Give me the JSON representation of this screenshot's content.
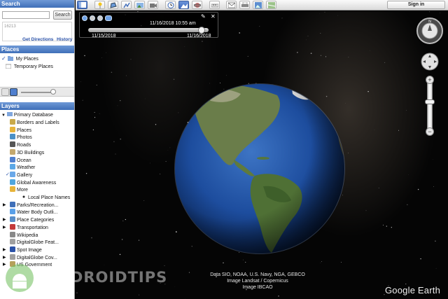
{
  "search": {
    "title": "Search",
    "button_label": "Search",
    "history_value": "16213",
    "get_directions": "Get Directions",
    "history_link": "History"
  },
  "places": {
    "title": "Places",
    "items": [
      {
        "label": "My Places",
        "icon": "folder-icon"
      },
      {
        "label": "Temporary Places",
        "icon": "folder-icon"
      }
    ]
  },
  "layers": {
    "title": "Layers",
    "root": "Primary Database",
    "items": [
      {
        "label": "Borders and Labels"
      },
      {
        "label": "Places"
      },
      {
        "label": "Photos"
      },
      {
        "label": "Roads"
      },
      {
        "label": "3D Buildings"
      },
      {
        "label": "Ocean"
      },
      {
        "label": "Weather"
      },
      {
        "label": "Gallery"
      },
      {
        "label": "Global Awareness"
      },
      {
        "label": "More"
      },
      {
        "label": "Local Place Names"
      },
      {
        "label": "Parks/Recreation..."
      },
      {
        "label": "Water Body Outli..."
      },
      {
        "label": "Place Categories"
      },
      {
        "label": "Transportation"
      },
      {
        "label": "Wikipedia"
      },
      {
        "label": "DigitalGlobe Feat..."
      },
      {
        "label": "Spot Image"
      },
      {
        "label": "DigitalGlobe Cov..."
      },
      {
        "label": "US Government"
      }
    ]
  },
  "toolbar": {
    "sign_in": "Sign in"
  },
  "time_slider": {
    "current": "11/16/2018  10:55 am",
    "start": "11/15/2018",
    "end": "11/16/2018",
    "position": 0.95
  },
  "map": {
    "attribution": [
      "Data SIO, NOAA, U.S. Navy, NGA, GEBCO",
      "Image Landsat / Copernicus",
      "Image IBCAO"
    ],
    "logo": "Google Earth"
  },
  "watermark": {
    "text": "GETDROIDTIPS"
  },
  "colors": {
    "panel_header": "#4a78c2",
    "link": "#2b52a8",
    "ocean": "#1d4d9e",
    "space": "#050505"
  }
}
